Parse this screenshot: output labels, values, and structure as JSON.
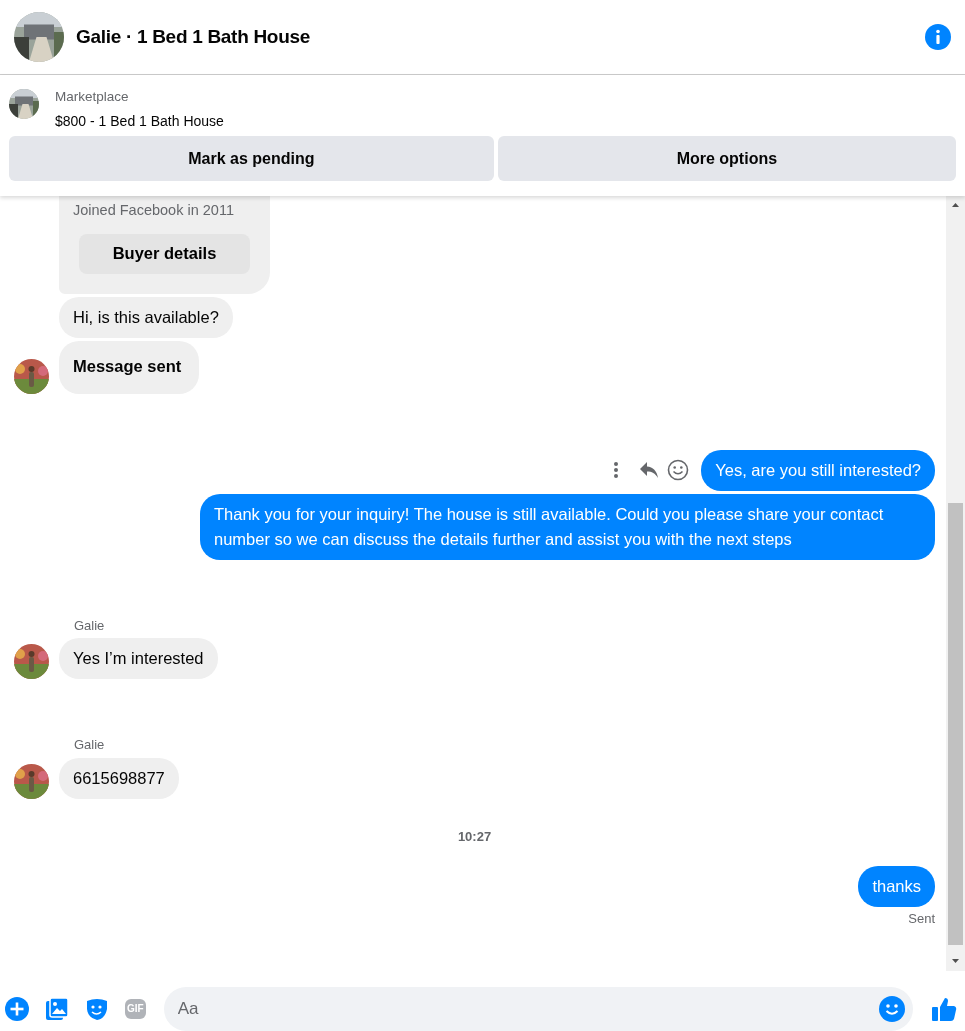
{
  "header": {
    "title": "Galie · 1 Bed 1 Bath House"
  },
  "listing": {
    "label": "Marketplace",
    "title": "$800 - 1 Bed 1 Bath House",
    "buttons": [
      "Mark as pending",
      "More options"
    ]
  },
  "groups": [
    {
      "kind": "incoming",
      "messages": [
        {
          "kind": "card",
          "caption": "Joined Facebook in 2011",
          "button": "Buyer details"
        },
        {
          "kind": "text",
          "text": "Hi, is this available?",
          "bold": false
        },
        {
          "kind": "text",
          "text": "Message sent",
          "bold": true
        }
      ]
    },
    {
      "kind": "outgoing",
      "messages": [
        {
          "kind": "text",
          "text": "Yes, are you still interested?",
          "actions": true
        },
        {
          "kind": "text",
          "text": "Thank you for your inquiry! The house is still available. Could you please share your contact number so we can discuss the details further and assist you with the next steps",
          "actions": false
        }
      ]
    },
    {
      "kind": "incoming",
      "sender": "Galie",
      "messages": [
        {
          "kind": "text",
          "text": "Yes I’m interested",
          "bold": false
        }
      ]
    },
    {
      "kind": "incoming",
      "sender": "Galie",
      "messages": [
        {
          "kind": "text",
          "text": "6615698877",
          "bold": false
        }
      ]
    },
    {
      "kind": "timestamp",
      "text": "10:27"
    },
    {
      "kind": "outgoing",
      "status": "Sent",
      "messages": [
        {
          "kind": "text",
          "text": "thanks",
          "actions": false
        }
      ]
    }
  ],
  "composer": {
    "placeholder": "Aa",
    "gif": "GIF"
  }
}
